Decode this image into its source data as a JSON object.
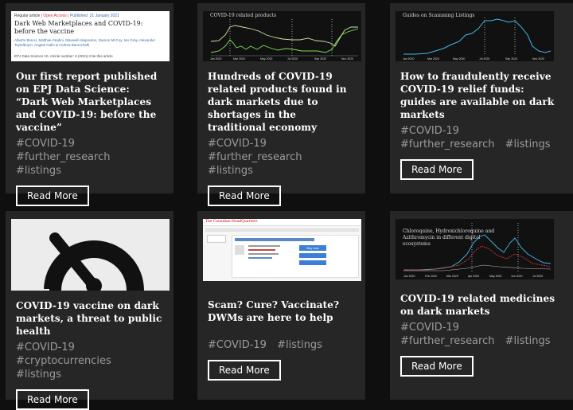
{
  "cards": [
    {
      "title": "Our first report published on EPJ Data Science: “Dark Web Marketplaces and COVID-19: before the vaccine”",
      "tags": [
        "#COVID-19",
        "#further_research",
        "#listings"
      ],
      "button": "Read More",
      "thumb": {
        "type": "paper",
        "meta_a": "Regular article",
        "meta_b": "Open Access",
        "meta_c": "Published: 21 January 2021",
        "title": "Dark Web Marketplaces and COVID-19: before the vaccine",
        "authors": "Alberto Bracci, Matthieu Nadini, Maxwell Aliapoulios, Damon McCoy, Ian Gray, Alexander Teytelboym, Angela Gallo & Andrea Baronchelli",
        "footer": "EPJ Data Science 10, Article number: 6 (2021)   Cite this article"
      }
    },
    {
      "title": "Hundreds of COVID-19 related products found in dark markets due to shortages in the traditional economy",
      "tags": [
        "#COVID-19",
        "#further_research",
        "#listings"
      ],
      "button": "Read More",
      "thumb": {
        "type": "chart",
        "title": "COVID-19 related products",
        "ticks": [
          "Jan 2020",
          "Mar 2020",
          "May 2020",
          "Jul 2020",
          "Sep 2020",
          "Nov 2020"
        ]
      }
    },
    {
      "title": "How to fraudulently receive COVID-19 relief funds: guides are available on dark markets",
      "tags": [
        "#COVID-19",
        "#further_research",
        "#listings"
      ],
      "button": "Read More",
      "thumb": {
        "type": "chart",
        "title": "Guides on Scamming Listings",
        "ticks": [
          "Jan 2020",
          "Mar 2020",
          "May 2020",
          "Jul 2020",
          "Sep 2020",
          "Nov 2020"
        ]
      }
    },
    {
      "title": "COVID-19 vaccine on dark markets, a threat to public health",
      "tags": [
        "#COVID-19",
        "#cryptocurrencies",
        "#listings"
      ],
      "button": "Read More",
      "thumb": {
        "type": "gauge"
      }
    },
    {
      "title": "Scam? Cure? Vaccinate? DWMs are here to help",
      "tags": [
        "#COVID-19",
        "#listings"
      ],
      "button": "Read More",
      "thumb": {
        "type": "web",
        "logo": "The Canadian HeadQuarters",
        "buy": "Buy now"
      }
    },
    {
      "title": "COVID-19 related medicines on dark markets",
      "tags": [
        "#COVID-19",
        "#further_research",
        "#listings"
      ],
      "button": "Read More",
      "thumb": {
        "type": "chart",
        "title": "Chloroquine, Hydroxichloroquine and Azithromycin in different digital ecosystems",
        "ticks": [
          "Jan 2020",
          "Feb 2020",
          "Mar 2020",
          "Apr 2020",
          "May 2020",
          "Jun 2020",
          "Jul 2020"
        ]
      }
    }
  ],
  "colors": {
    "card": "#262626",
    "page": "#0f0f0f",
    "accent_green": "#7ee05a",
    "accent_blue": "#3fb8e8"
  }
}
